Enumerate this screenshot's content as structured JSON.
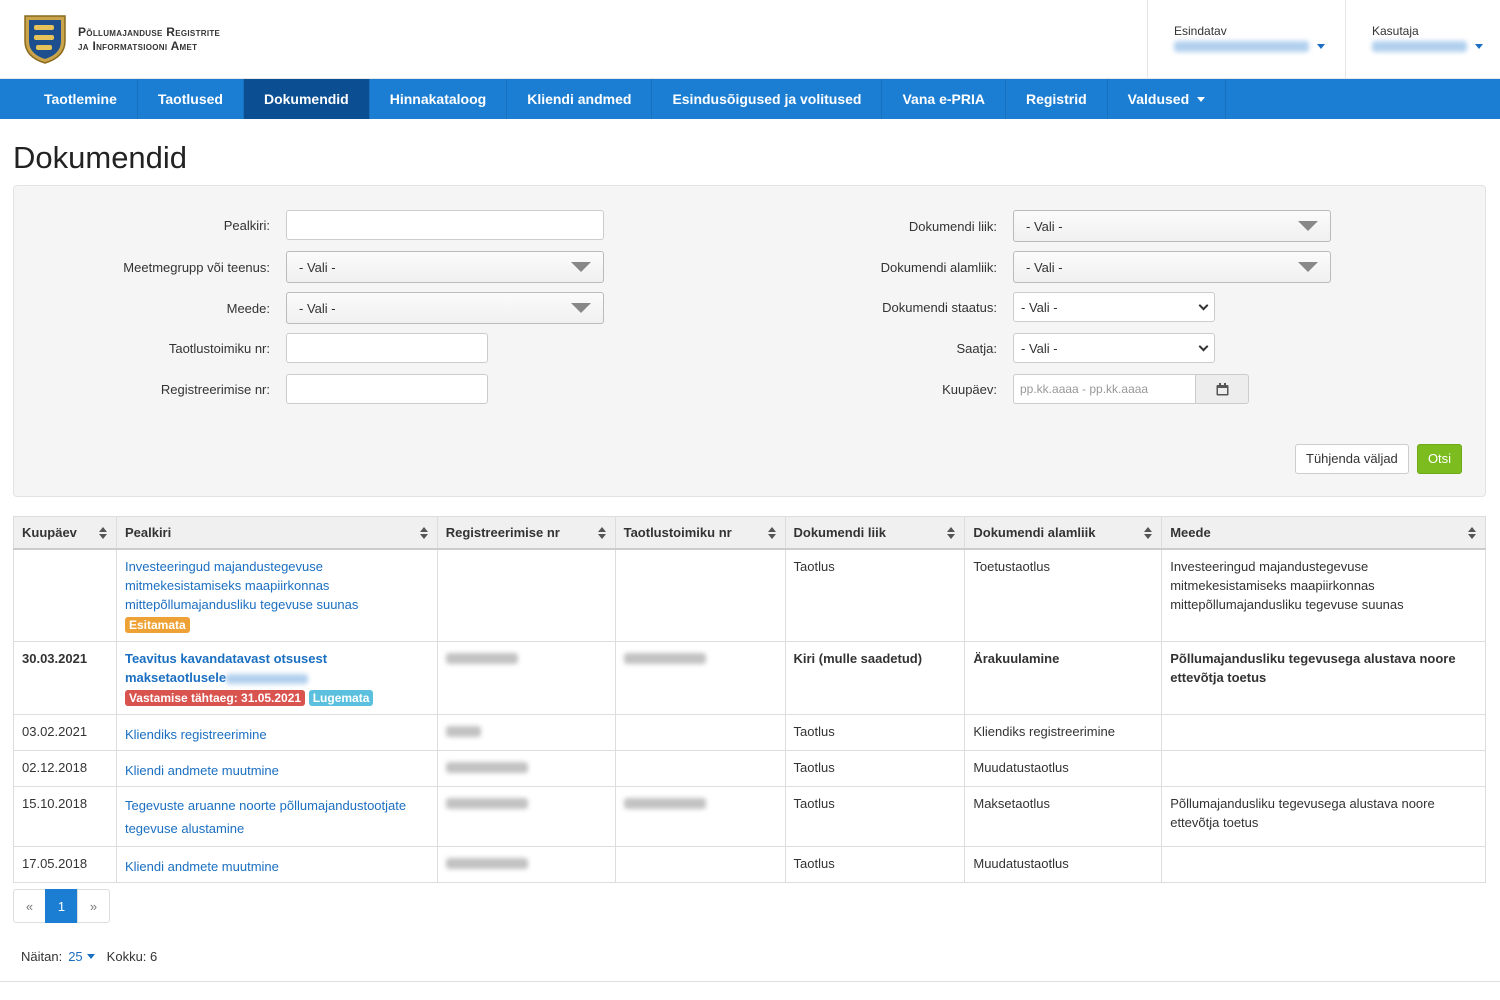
{
  "header": {
    "logo_line1": "Põllumajanduse Registrite",
    "logo_line2": "ja Informatsiooni Amet",
    "represent_label": "Esindatav",
    "user_label": "Kasutaja"
  },
  "nav": [
    {
      "label": "Taotlemine"
    },
    {
      "label": "Taotlused"
    },
    {
      "label": "Dokumendid"
    },
    {
      "label": "Hinnakataloog"
    },
    {
      "label": "Kliendi andmed"
    },
    {
      "label": "Esindusõigused ja volitused"
    },
    {
      "label": "Vana e-PRIA"
    },
    {
      "label": "Registrid"
    },
    {
      "label": "Valdused"
    }
  ],
  "page_title": "Dokumendid",
  "filters": {
    "title_label": "Pealkiri:",
    "measuregroup_label": "Meetmegrupp või teenus:",
    "measure_label": "Meede:",
    "app_file_label": "Taotlustoimiku nr:",
    "reg_label": "Registreerimise nr:",
    "doctype_label": "Dokumendi liik:",
    "docsubtype_label": "Dokumendi alamliik:",
    "docstatus_label": "Dokumendi staatus:",
    "sender_label": "Saatja:",
    "date_label": "Kuupäev:",
    "select_default": "- Vali -",
    "date_placeholder": "pp.kk.aaaa - pp.kk.aaaa",
    "clear_button": "Tühjenda väljad",
    "search_button": "Otsi"
  },
  "table": {
    "headers": [
      "Kuupäev",
      "Pealkiri",
      "Registreerimise nr",
      "Taotlustoimiku nr",
      "Dokumendi liik",
      "Dokumendi alamliik",
      "Meede"
    ],
    "rows": [
      {
        "date": "",
        "title_l1": "Investeeringud majandustegevuse",
        "title_l2": "mitmekesistamiseks maapiirkonnas",
        "title_l3": "mittepõllumajandusliku tegevuse suunas",
        "badge": "Esitamata",
        "type": "Taotlus",
        "subtype": "Toetustaotlus",
        "measure_l1": "Investeeringud majandustegevuse",
        "measure_l2": "mitmekesistamiseks maapiirkonnas",
        "measure_l3": "mittepõllumajandusliku tegevuse suunas"
      },
      {
        "date": "30.03.2021",
        "title_l1": "Teavitus kavandatavast otsusest",
        "title_l2": "maksetaotlusele",
        "badge1": "Vastamise tähtaeg: 31.05.2021",
        "badge2": "Lugemata",
        "type": "Kiri (mulle saadetud)",
        "subtype": "Ärakuulamine",
        "measure_l1": "Põllumajandusliku tegevusega alustava noore",
        "measure_l2": "ettevõtja toetus"
      },
      {
        "date": "03.02.2021",
        "title": "Kliendiks registreerimine",
        "type": "Taotlus",
        "subtype": "Kliendiks registreerimine"
      },
      {
        "date": "02.12.2018",
        "title": "Kliendi andmete muutmine",
        "type": "Taotlus",
        "subtype": "Muudatustaotlus"
      },
      {
        "date": "15.10.2018",
        "title_l1": "Tegevuste aruanne noorte põllumajandustootjate",
        "title_l2": "tegevuse alustamine",
        "type": "Taotlus",
        "subtype": "Maksetaotlus",
        "measure_l1": "Põllumajandusliku tegevusega alustava noore",
        "measure_l2": "ettevõtja toetus"
      },
      {
        "date": "17.05.2018",
        "title": "Kliendi andmete muutmine",
        "type": "Taotlus",
        "subtype": "Muudatustaotlus"
      }
    ]
  },
  "pagination": {
    "prev": "«",
    "current": "1",
    "next": "»"
  },
  "footer": {
    "show_label": "Näitan:",
    "per_page": "25",
    "total": "Kokku: 6"
  },
  "colors": {
    "nav_bg": "#1b7ed3",
    "nav_active": "#0b4f92",
    "search_btn": "#7cbc1f",
    "link": "#1b6fc1"
  }
}
